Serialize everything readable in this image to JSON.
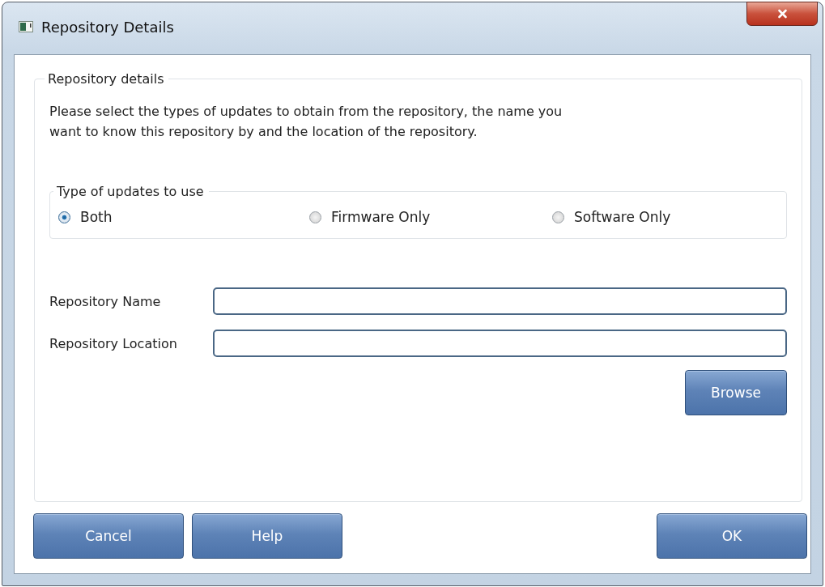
{
  "window": {
    "title": "Repository Details"
  },
  "group": {
    "title": "Repository details",
    "description": "Please select the types of updates to obtain from the repository, the name you\nwant to know this repository by and the location of the repository."
  },
  "update_type": {
    "title": "Type of updates to use",
    "options": [
      {
        "label": "Both",
        "selected": true
      },
      {
        "label": "Firmware Only",
        "selected": false
      },
      {
        "label": "Software Only",
        "selected": false
      }
    ]
  },
  "fields": [
    {
      "label": "Repository Name"
    },
    {
      "label": "Repository Location"
    }
  ],
  "browse_button": "Browse",
  "buttons": {
    "left": [
      "Cancel",
      "Help"
    ],
    "right": [
      "OK"
    ]
  }
}
